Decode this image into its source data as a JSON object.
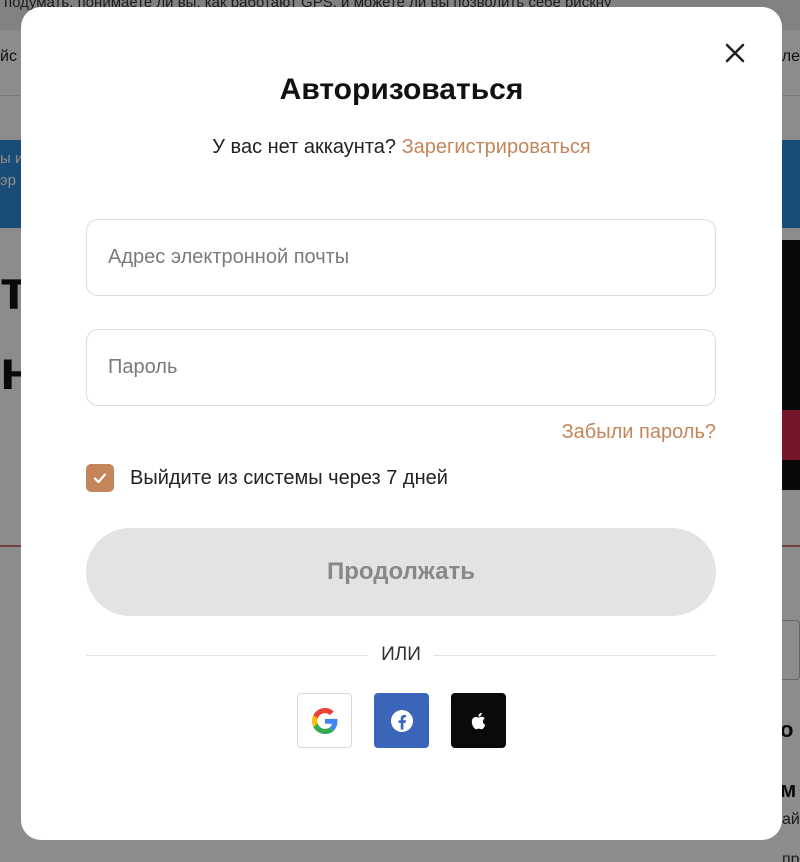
{
  "background": {
    "topbar_text": "подумать, понимаете ли вы, как работают GPS, и можете ли вы позволить себе рискну",
    "nav_left": "йс",
    "nav_right": "ле",
    "banner_text_1": "ы и",
    "banner_text_2": "эр",
    "heading_1": "т",
    "heading_2": "н",
    "right_text_1": "о",
    "right_text_2": "м",
    "right_small_1": "ай",
    "right_small_2": "прог"
  },
  "modal": {
    "title": "Авторизоваться",
    "signup_prompt": "У вас нет аккаунта?",
    "signup_link": "Зарегистрироваться",
    "email_placeholder": "Адрес электронной почты",
    "password_placeholder": "Пароль",
    "forgot_password": "Забыли пароль?",
    "remember_label": "Выйдите из системы через 7 дней",
    "remember_checked": true,
    "continue_label": "Продолжать",
    "divider_text": "ИЛИ",
    "social": [
      {
        "name": "google",
        "icon": "google-icon"
      },
      {
        "name": "facebook",
        "icon": "facebook-icon"
      },
      {
        "name": "apple",
        "icon": "apple-icon"
      }
    ]
  },
  "colors": {
    "accent": "#c4855b",
    "facebook": "#3b65b8",
    "apple": "#0a0a0a",
    "button_disabled": "#e3e3e3"
  }
}
